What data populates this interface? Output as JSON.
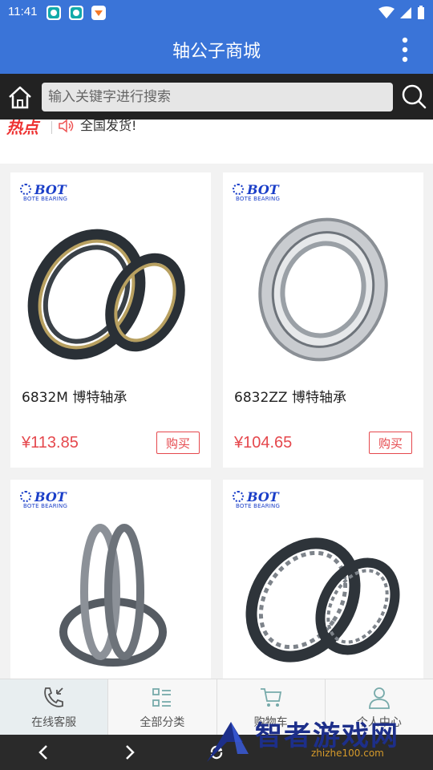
{
  "status": {
    "time": "11:41"
  },
  "app": {
    "title": "轴公子商城"
  },
  "search": {
    "placeholder": "输入关键字进行搜索"
  },
  "hot": {
    "tag": "热点",
    "text": "全国发货!"
  },
  "products": [
    {
      "brand": "BOT",
      "brand_sub": "BOTE BEARING",
      "name": "6832M 博特轴承",
      "price": "¥113.85",
      "buy_label": "购买"
    },
    {
      "brand": "BOT",
      "brand_sub": "BOTE BEARING",
      "name": "6832ZZ 博特轴承",
      "price": "¥104.65",
      "buy_label": "购买"
    },
    {
      "brand": "BOT",
      "brand_sub": "BOTE BEARING"
    },
    {
      "brand": "BOT",
      "brand_sub": "BOTE BEARING"
    }
  ],
  "bottom_nav": [
    {
      "label": "在线客服",
      "icon": "phone-icon",
      "active": true
    },
    {
      "label": "全部分类",
      "icon": "category-list-icon"
    },
    {
      "label": "购物车",
      "icon": "cart-icon"
    },
    {
      "label": "个人中心",
      "icon": "user-icon"
    }
  ],
  "watermark": {
    "text": "智者游戏网",
    "sub": "zhizhe100.com"
  },
  "colors": {
    "primary": "#3a74d8",
    "price": "#e5484d",
    "brand": "#1a3ec8"
  }
}
